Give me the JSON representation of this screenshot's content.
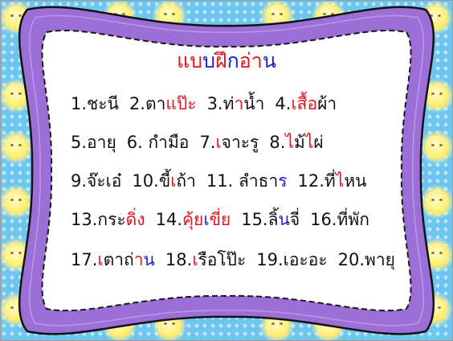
{
  "colors": {
    "black": "#111111",
    "red": "#e8141d",
    "blue": "#1f1fd2",
    "green": "#16a33a",
    "sky": "#6cc6ef",
    "frame_purple": "#9b6fd6",
    "sun_yellow": "#fff07a"
  },
  "decor": {
    "background_icon": "sun-icon",
    "frame_icon": "scalloped-frame-icon"
  },
  "title": [
    {
      "text": "แบ",
      "color": "red"
    },
    {
      "text": "บ",
      "color": "blue"
    },
    {
      "text": "ฝึ",
      "color": "red"
    },
    {
      "text": "ก",
      "color": "blue"
    },
    {
      "text": "อ่",
      "color": "red"
    },
    {
      "text": "า",
      "color": "red"
    },
    {
      "text": "น",
      "color": "blue"
    }
  ],
  "rows": [
    [
      {
        "segments": [
          {
            "text": "1.ชะนี",
            "color": "black"
          }
        ]
      },
      {
        "segments": [
          {
            "text": "2.ตา",
            "color": "black"
          },
          {
            "text": "แป๊ะ",
            "color": "red"
          }
        ]
      },
      {
        "segments": [
          {
            "text": "3.ท่",
            "color": "black"
          },
          {
            "text": "า",
            "color": "red"
          },
          {
            "text": "น้ำ",
            "color": "black"
          }
        ]
      },
      {
        "segments": [
          {
            "text": "4.",
            "color": "black"
          },
          {
            "text": "เสื้อ",
            "color": "red"
          },
          {
            "text": "ผ้า",
            "color": "black"
          }
        ]
      }
    ],
    [
      {
        "segments": [
          {
            "text": "5.อายุ",
            "color": "black"
          }
        ]
      },
      {
        "segments": [
          {
            "text": "6. ก",
            "color": "black"
          },
          {
            "text": "ำ",
            "color": "red"
          },
          {
            "text": "มือ",
            "color": "black"
          }
        ]
      },
      {
        "segments": [
          {
            "text": "7.",
            "color": "black"
          },
          {
            "text": "เ",
            "color": "red"
          },
          {
            "text": "จาะรู",
            "color": "black"
          }
        ]
      },
      {
        "segments": [
          {
            "text": "8.",
            "color": "black"
          },
          {
            "text": "ไ",
            "color": "red"
          },
          {
            "text": "ม้",
            "color": "black"
          },
          {
            "text": "ไ",
            "color": "red"
          },
          {
            "text": "ผ่",
            "color": "black"
          }
        ]
      }
    ],
    [
      {
        "segments": [
          {
            "text": "9.จ๊ะเอ๋",
            "color": "black"
          }
        ]
      },
      {
        "segments": [
          {
            "text": "10.ขี้",
            "color": "black"
          },
          {
            "text": "เ",
            "color": "red"
          },
          {
            "text": "ถ้า",
            "color": "black"
          }
        ]
      },
      {
        "segments": [
          {
            "text": "11. ลำธา",
            "color": "black"
          },
          {
            "text": "ร",
            "color": "blue"
          }
        ]
      },
      {
        "segments": [
          {
            "text": "12.ที่",
            "color": "black"
          },
          {
            "text": "ไ",
            "color": "red"
          },
          {
            "text": "หน",
            "color": "black"
          }
        ]
      }
    ],
    [
      {
        "segments": [
          {
            "text": "13.กระ",
            "color": "black"
          },
          {
            "text": "ดิ่ง",
            "color": "red"
          }
        ]
      },
      {
        "segments": [
          {
            "text": "14.",
            "color": "black"
          },
          {
            "text": "คุ้ย",
            "color": "red"
          },
          {
            "text": "เ",
            "color": "blue"
          },
          {
            "text": "ขี่ย",
            "color": "red"
          }
        ]
      },
      {
        "segments": [
          {
            "text": "15.ลิ้",
            "color": "black"
          },
          {
            "text": "น",
            "color": "blue"
          },
          {
            "text": "จี่",
            "color": "black"
          }
        ]
      },
      {
        "segments": [
          {
            "text": "16.ที่พัก",
            "color": "black"
          }
        ]
      }
    ],
    [
      {
        "segments": [
          {
            "text": "17.",
            "color": "black"
          },
          {
            "text": "เ",
            "color": "red"
          },
          {
            "text": "ตาถ่",
            "color": "black"
          },
          {
            "text": "า",
            "color": "red"
          },
          {
            "text": "น",
            "color": "blue"
          }
        ]
      },
      {
        "segments": [
          {
            "text": "18.",
            "color": "black"
          },
          {
            "text": "เ",
            "color": "red"
          },
          {
            "text": "รือโป๊ะ",
            "color": "black"
          }
        ]
      },
      {
        "segments": [
          {
            "text": "19.เอะอะ",
            "color": "black"
          }
        ]
      },
      {
        "segments": [
          {
            "text": "20.พายุ",
            "color": "black"
          }
        ]
      }
    ]
  ]
}
